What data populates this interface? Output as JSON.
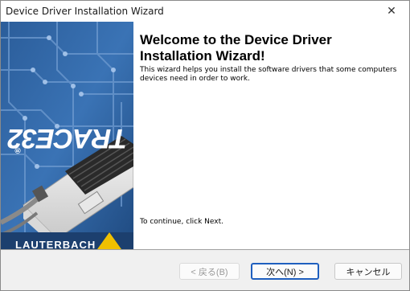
{
  "window": {
    "title": "Device Driver Installation Wizard",
    "close_glyph": "✕"
  },
  "banner": {
    "brand": "TRACE32",
    "registered": "®",
    "partial_brand": "LAUTERBACH"
  },
  "main": {
    "heading": "Welcome to the Device Driver Installation Wizard!",
    "description": "This wizard helps you install the software drivers that some computers devices need in order to work.",
    "continue_text": "To continue, click Next."
  },
  "buttons": {
    "back": "< 戻る(B)",
    "next": "次へ(N) >",
    "cancel": "キャンセル"
  },
  "colors": {
    "banner_blue": "#2d5d98",
    "accent": "#1f5fbf"
  }
}
